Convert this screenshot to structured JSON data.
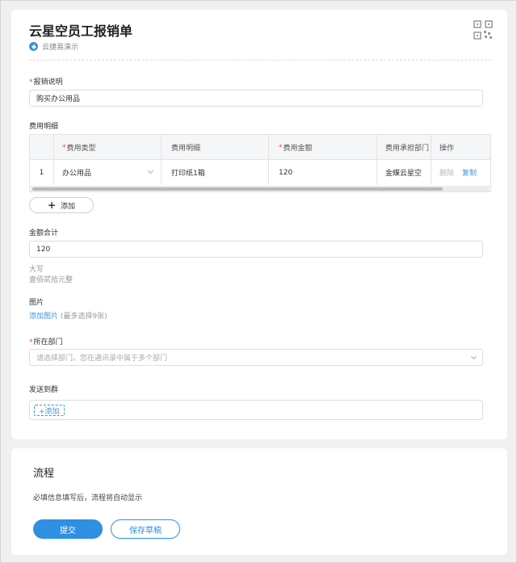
{
  "form": {
    "title": "云星空员工报销单",
    "source": "云捷易演示"
  },
  "reason": {
    "label": "报销说明",
    "value": "购买办公用品"
  },
  "details": {
    "label": "费用明细",
    "headers": [
      "",
      "费用类型",
      "费用明细",
      "费用金额",
      "费用承担部门",
      "操作"
    ],
    "rows": [
      {
        "index": "1",
        "type": "办公用品",
        "detail": "打印纸1箱",
        "amount": "120",
        "dept": "金蝶云星空",
        "delete": "删除",
        "copy": "复制"
      }
    ],
    "add_label": "添加"
  },
  "total": {
    "label": "金额合计",
    "value": "120",
    "caps_label": "大写",
    "caps_value": "壹佰贰拾元整"
  },
  "image": {
    "label": "图片",
    "add_link": "添加图片",
    "hint": "(最多选择9张)"
  },
  "department": {
    "label": "所在部门",
    "placeholder": "请选择部门。您在通讯录中属于多个部门"
  },
  "group": {
    "label": "发送到群",
    "add_label": "+添加"
  },
  "flow": {
    "title": "流程",
    "note": "必填信息填写后，流程将自动显示",
    "submit": "提交",
    "save_draft": "保存草稿"
  }
}
